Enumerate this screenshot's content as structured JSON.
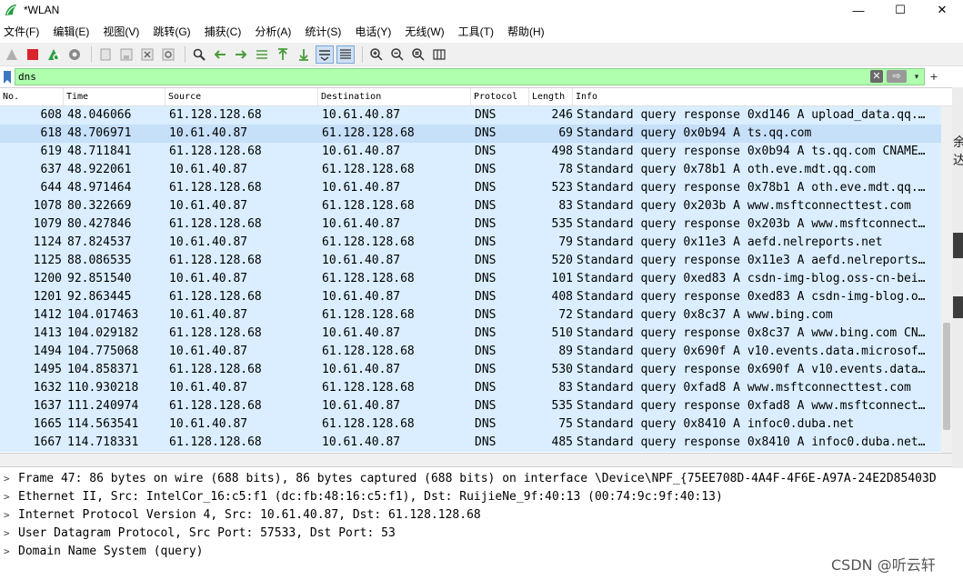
{
  "window": {
    "title": "*WLAN",
    "minimize": "—",
    "maximize": "☐",
    "close": "✕"
  },
  "menu": [
    "文件(F)",
    "编辑(E)",
    "视图(V)",
    "跳转(G)",
    "捕获(C)",
    "分析(A)",
    "统计(S)",
    "电话(Y)",
    "无线(W)",
    "工具(T)",
    "帮助(H)"
  ],
  "filter": {
    "value": "dns",
    "clear": "✕",
    "apply": "⇨",
    "dropdown": "▾",
    "add": "+"
  },
  "columns": [
    "No.",
    "Time",
    "Source",
    "Destination",
    "Protocol",
    "Length",
    "Info"
  ],
  "packets": [
    {
      "no": "608",
      "time": "48.046066",
      "src": "61.128.128.68",
      "dst": "10.61.40.87",
      "proto": "DNS",
      "len": "246",
      "info": "Standard query response 0xd146 A upload_data.qq.…"
    },
    {
      "no": "618",
      "time": "48.706971",
      "src": "10.61.40.87",
      "dst": "61.128.128.68",
      "proto": "DNS",
      "len": "69",
      "info": "Standard query 0x0b94 A ts.qq.com"
    },
    {
      "no": "619",
      "time": "48.711841",
      "src": "61.128.128.68",
      "dst": "10.61.40.87",
      "proto": "DNS",
      "len": "498",
      "info": "Standard query response 0x0b94 A ts.qq.com CNAME…"
    },
    {
      "no": "637",
      "time": "48.922061",
      "src": "10.61.40.87",
      "dst": "61.128.128.68",
      "proto": "DNS",
      "len": "78",
      "info": "Standard query 0x78b1 A oth.eve.mdt.qq.com"
    },
    {
      "no": "644",
      "time": "48.971464",
      "src": "61.128.128.68",
      "dst": "10.61.40.87",
      "proto": "DNS",
      "len": "523",
      "info": "Standard query response 0x78b1 A oth.eve.mdt.qq.…"
    },
    {
      "no": "1078",
      "time": "80.322669",
      "src": "10.61.40.87",
      "dst": "61.128.128.68",
      "proto": "DNS",
      "len": "83",
      "info": "Standard query 0x203b A www.msftconnecttest.com"
    },
    {
      "no": "1079",
      "time": "80.427846",
      "src": "61.128.128.68",
      "dst": "10.61.40.87",
      "proto": "DNS",
      "len": "535",
      "info": "Standard query response 0x203b A www.msftconnect…"
    },
    {
      "no": "1124",
      "time": "87.824537",
      "src": "10.61.40.87",
      "dst": "61.128.128.68",
      "proto": "DNS",
      "len": "79",
      "info": "Standard query 0x11e3 A aefd.nelreports.net"
    },
    {
      "no": "1125",
      "time": "88.086535",
      "src": "61.128.128.68",
      "dst": "10.61.40.87",
      "proto": "DNS",
      "len": "520",
      "info": "Standard query response 0x11e3 A aefd.nelreports…"
    },
    {
      "no": "1200",
      "time": "92.851540",
      "src": "10.61.40.87",
      "dst": "61.128.128.68",
      "proto": "DNS",
      "len": "101",
      "info": "Standard query 0xed83 A csdn-img-blog.oss-cn-bei…"
    },
    {
      "no": "1201",
      "time": "92.863445",
      "src": "61.128.128.68",
      "dst": "10.61.40.87",
      "proto": "DNS",
      "len": "408",
      "info": "Standard query response 0xed83 A csdn-img-blog.o…"
    },
    {
      "no": "1412",
      "time": "104.017463",
      "src": "10.61.40.87",
      "dst": "61.128.128.68",
      "proto": "DNS",
      "len": "72",
      "info": "Standard query 0x8c37 A www.bing.com"
    },
    {
      "no": "1413",
      "time": "104.029182",
      "src": "61.128.128.68",
      "dst": "10.61.40.87",
      "proto": "DNS",
      "len": "510",
      "info": "Standard query response 0x8c37 A www.bing.com CN…"
    },
    {
      "no": "1494",
      "time": "104.775068",
      "src": "10.61.40.87",
      "dst": "61.128.128.68",
      "proto": "DNS",
      "len": "89",
      "info": "Standard query 0x690f A v10.events.data.microsof…"
    },
    {
      "no": "1495",
      "time": "104.858371",
      "src": "61.128.128.68",
      "dst": "10.61.40.87",
      "proto": "DNS",
      "len": "530",
      "info": "Standard query response 0x690f A v10.events.data…"
    },
    {
      "no": "1632",
      "time": "110.930218",
      "src": "10.61.40.87",
      "dst": "61.128.128.68",
      "proto": "DNS",
      "len": "83",
      "info": "Standard query 0xfad8 A www.msftconnecttest.com"
    },
    {
      "no": "1637",
      "time": "111.240974",
      "src": "61.128.128.68",
      "dst": "10.61.40.87",
      "proto": "DNS",
      "len": "535",
      "info": "Standard query response 0xfad8 A www.msftconnect…"
    },
    {
      "no": "1665",
      "time": "114.563541",
      "src": "10.61.40.87",
      "dst": "61.128.128.68",
      "proto": "DNS",
      "len": "75",
      "info": "Standard query 0x8410 A infoc0.duba.net"
    },
    {
      "no": "1667",
      "time": "114.718331",
      "src": "61.128.128.68",
      "dst": "10.61.40.87",
      "proto": "DNS",
      "len": "485",
      "info": "Standard query response 0x8410 A infoc0.duba.net…"
    }
  ],
  "details": [
    "Frame 47: 86 bytes on wire (688 bits), 86 bytes captured (688 bits) on interface \\Device\\NPF_{75EE708D-4A4F-4F6E-A97A-24E2D85403D",
    "Ethernet II, Src: IntelCor_16:c5:f1 (dc:fb:48:16:c5:f1), Dst: RuijieNe_9f:40:13 (00:74:9c:9f:40:13)",
    "Internet Protocol Version 4, Src: 10.61.40.87, Dst: 61.128.128.68",
    "User Datagram Protocol, Src Port: 57533, Dst Port: 53",
    "Domain Name System (query)"
  ],
  "detail_arrow": ">",
  "side_snippets": [
    "余",
    "达"
  ],
  "watermark": "CSDN @听云轩",
  "colors": {
    "row_bg": "#daeeff",
    "selected_row_bg": "#c6e0f9",
    "filter_bg": "#afffaf"
  }
}
